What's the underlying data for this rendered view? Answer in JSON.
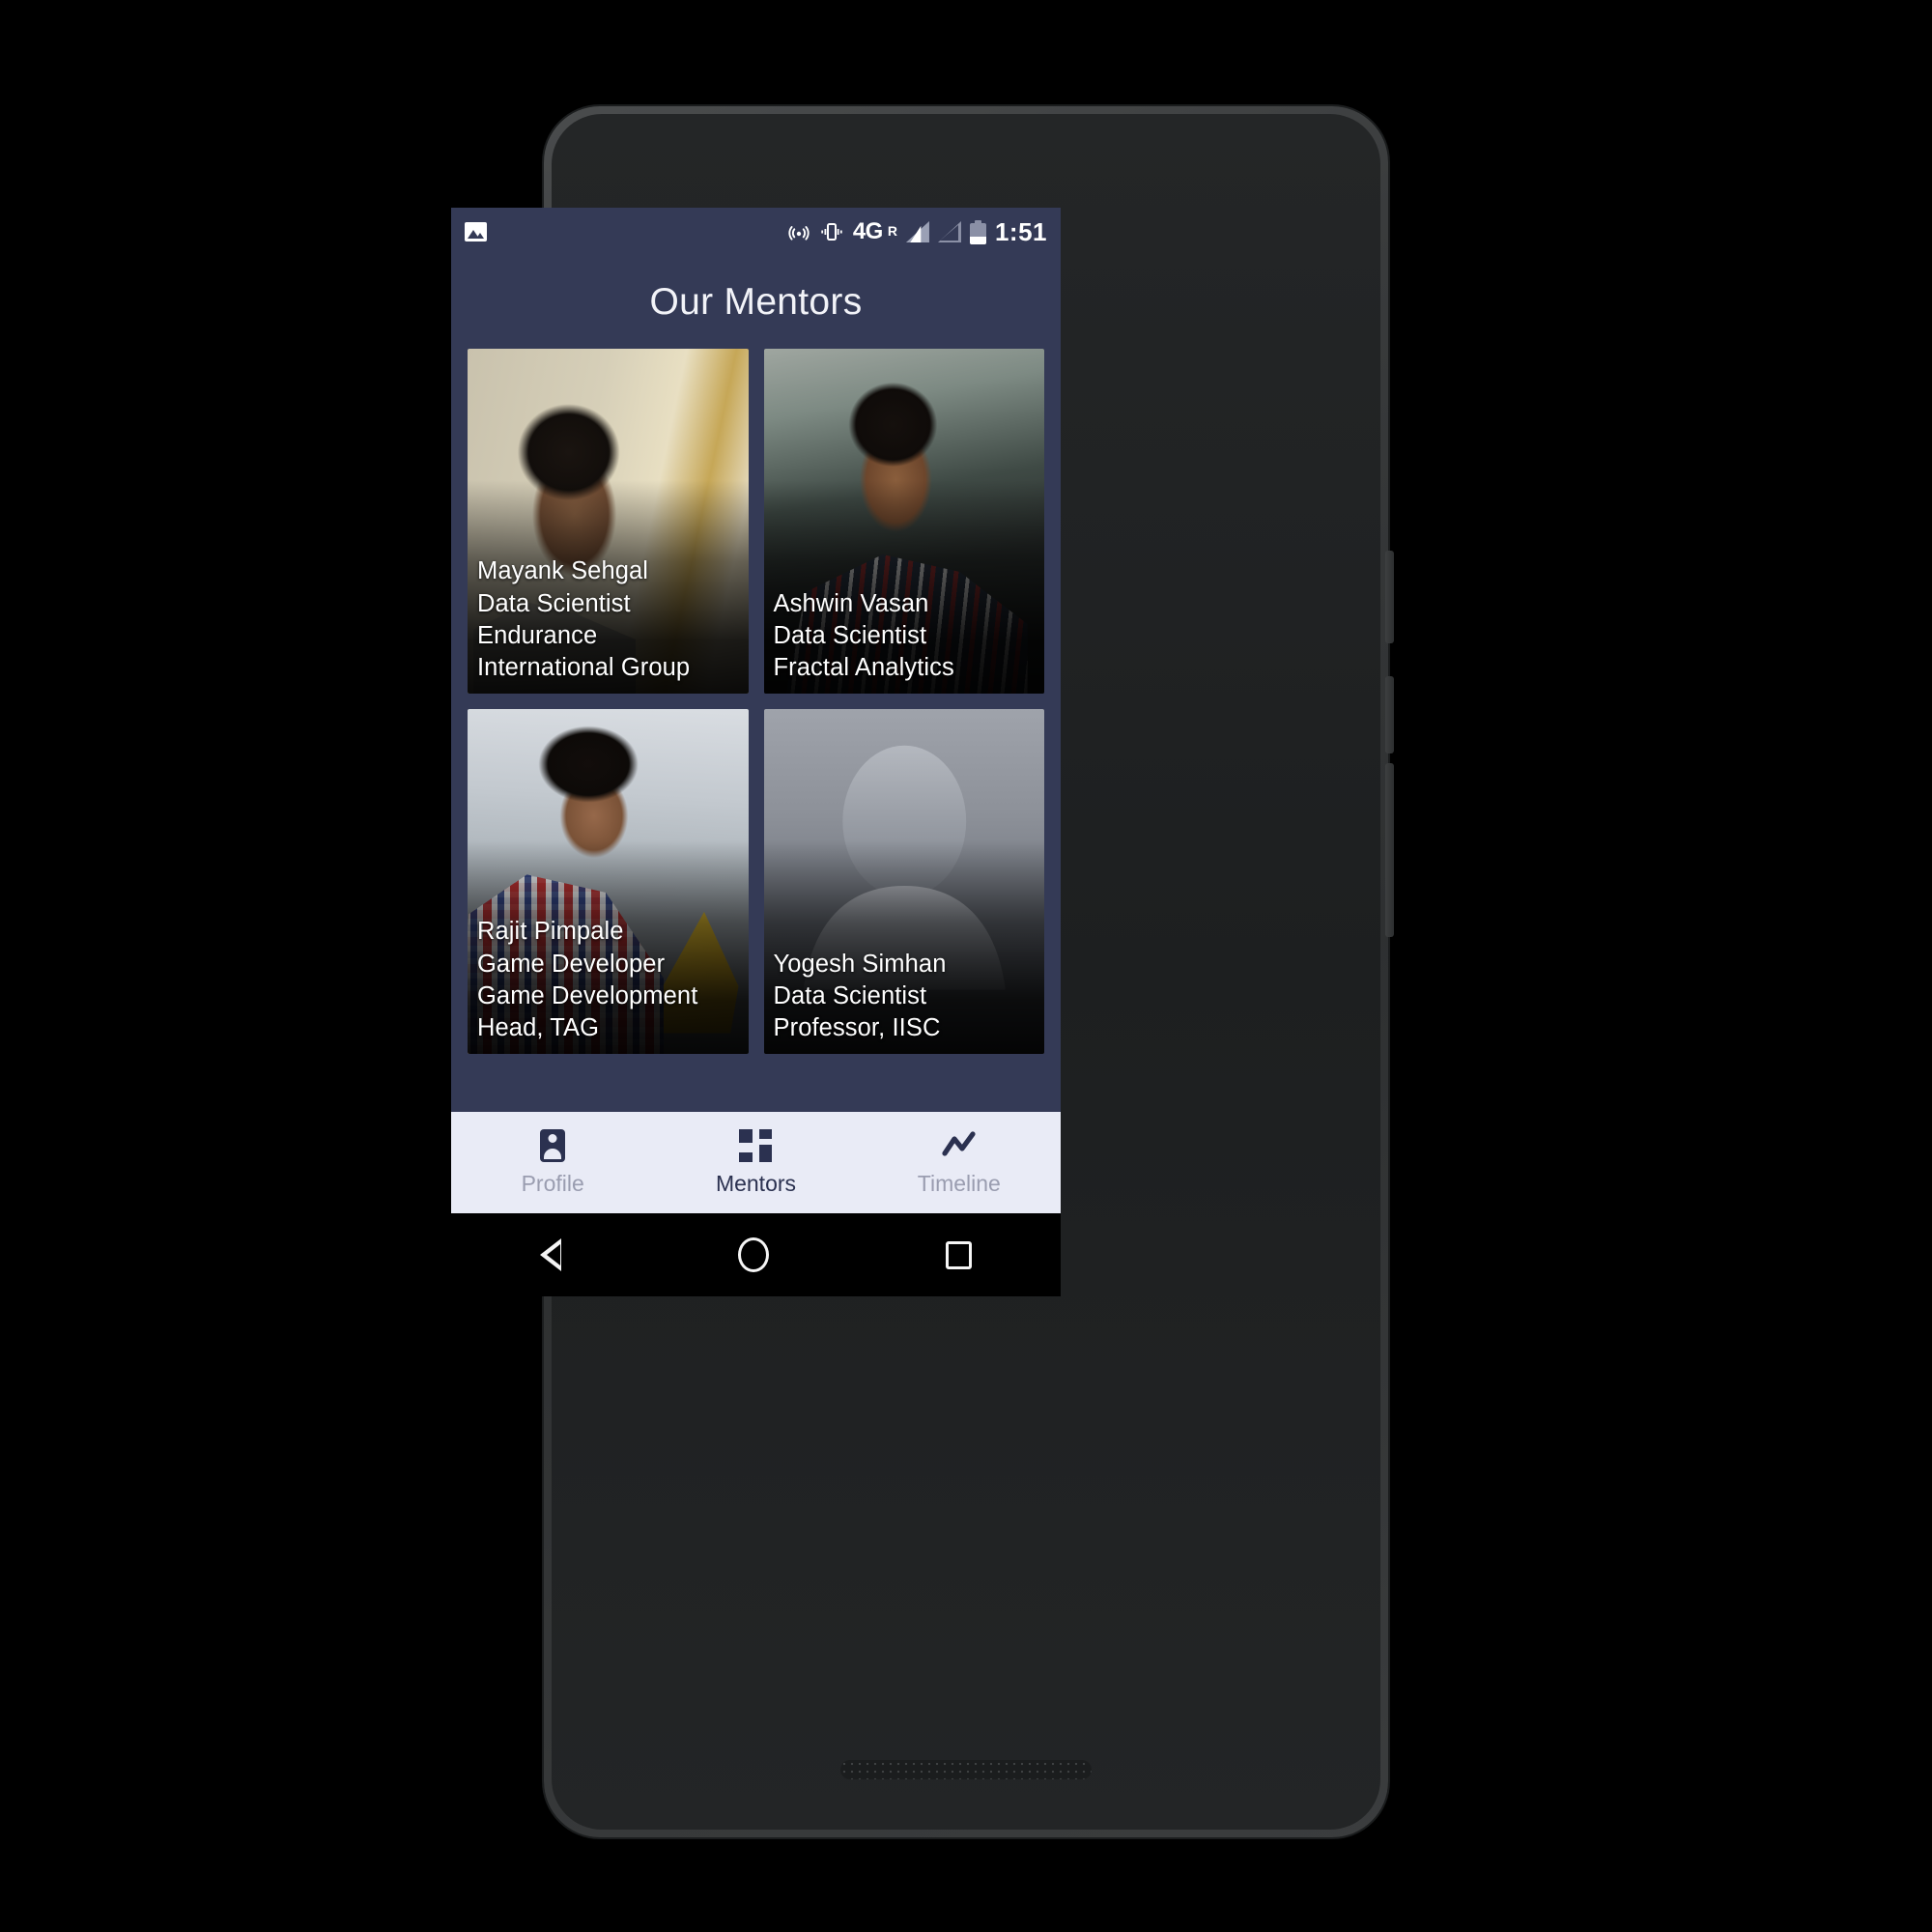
{
  "status_bar": {
    "left_icons": [
      "photo-icon"
    ],
    "right_icons": [
      "cast-icon",
      "vibrate-icon",
      "signal-icon",
      "signal-empty-icon",
      "battery-icon"
    ],
    "network_type": "4G",
    "roaming": "R",
    "time": "1:51"
  },
  "app_bar": {
    "title": "Our Mentors"
  },
  "mentors": [
    {
      "name": "Mayank Sehgal",
      "role": "Data Scientist",
      "org": "Endurance International Group",
      "photo": "mayank-sehgal-photo"
    },
    {
      "name": "Ashwin Vasan",
      "role": "Data Scientist",
      "org": "Fractal Analytics",
      "photo": "ashwin-vasan-photo"
    },
    {
      "name": "Rajit Pimpale",
      "role": "Game Developer",
      "org": "Game Development Head, TAG",
      "photo": "rajit-pimpale-photo"
    },
    {
      "name": "Yogesh Simhan",
      "role": "Data Scientist",
      "org": "Professor, IISC",
      "photo": "placeholder-avatar"
    }
  ],
  "bottom_nav": {
    "items": [
      {
        "label": "Profile",
        "icon": "contact-badge-icon",
        "active": false
      },
      {
        "label": "Mentors",
        "icon": "dashboard-grid-icon",
        "active": true
      },
      {
        "label": "Timeline",
        "icon": "trend-line-icon",
        "active": false
      }
    ]
  },
  "android_nav": {
    "back": "back-triangle-icon",
    "home": "home-circle-icon",
    "recents": "recents-square-icon"
  },
  "colors": {
    "primary": "#343a56",
    "nav_background": "#e9ebf6",
    "nav_active": "#2b3150",
    "nav_inactive": "#9a9db0",
    "screen_text": "#ffffff"
  }
}
